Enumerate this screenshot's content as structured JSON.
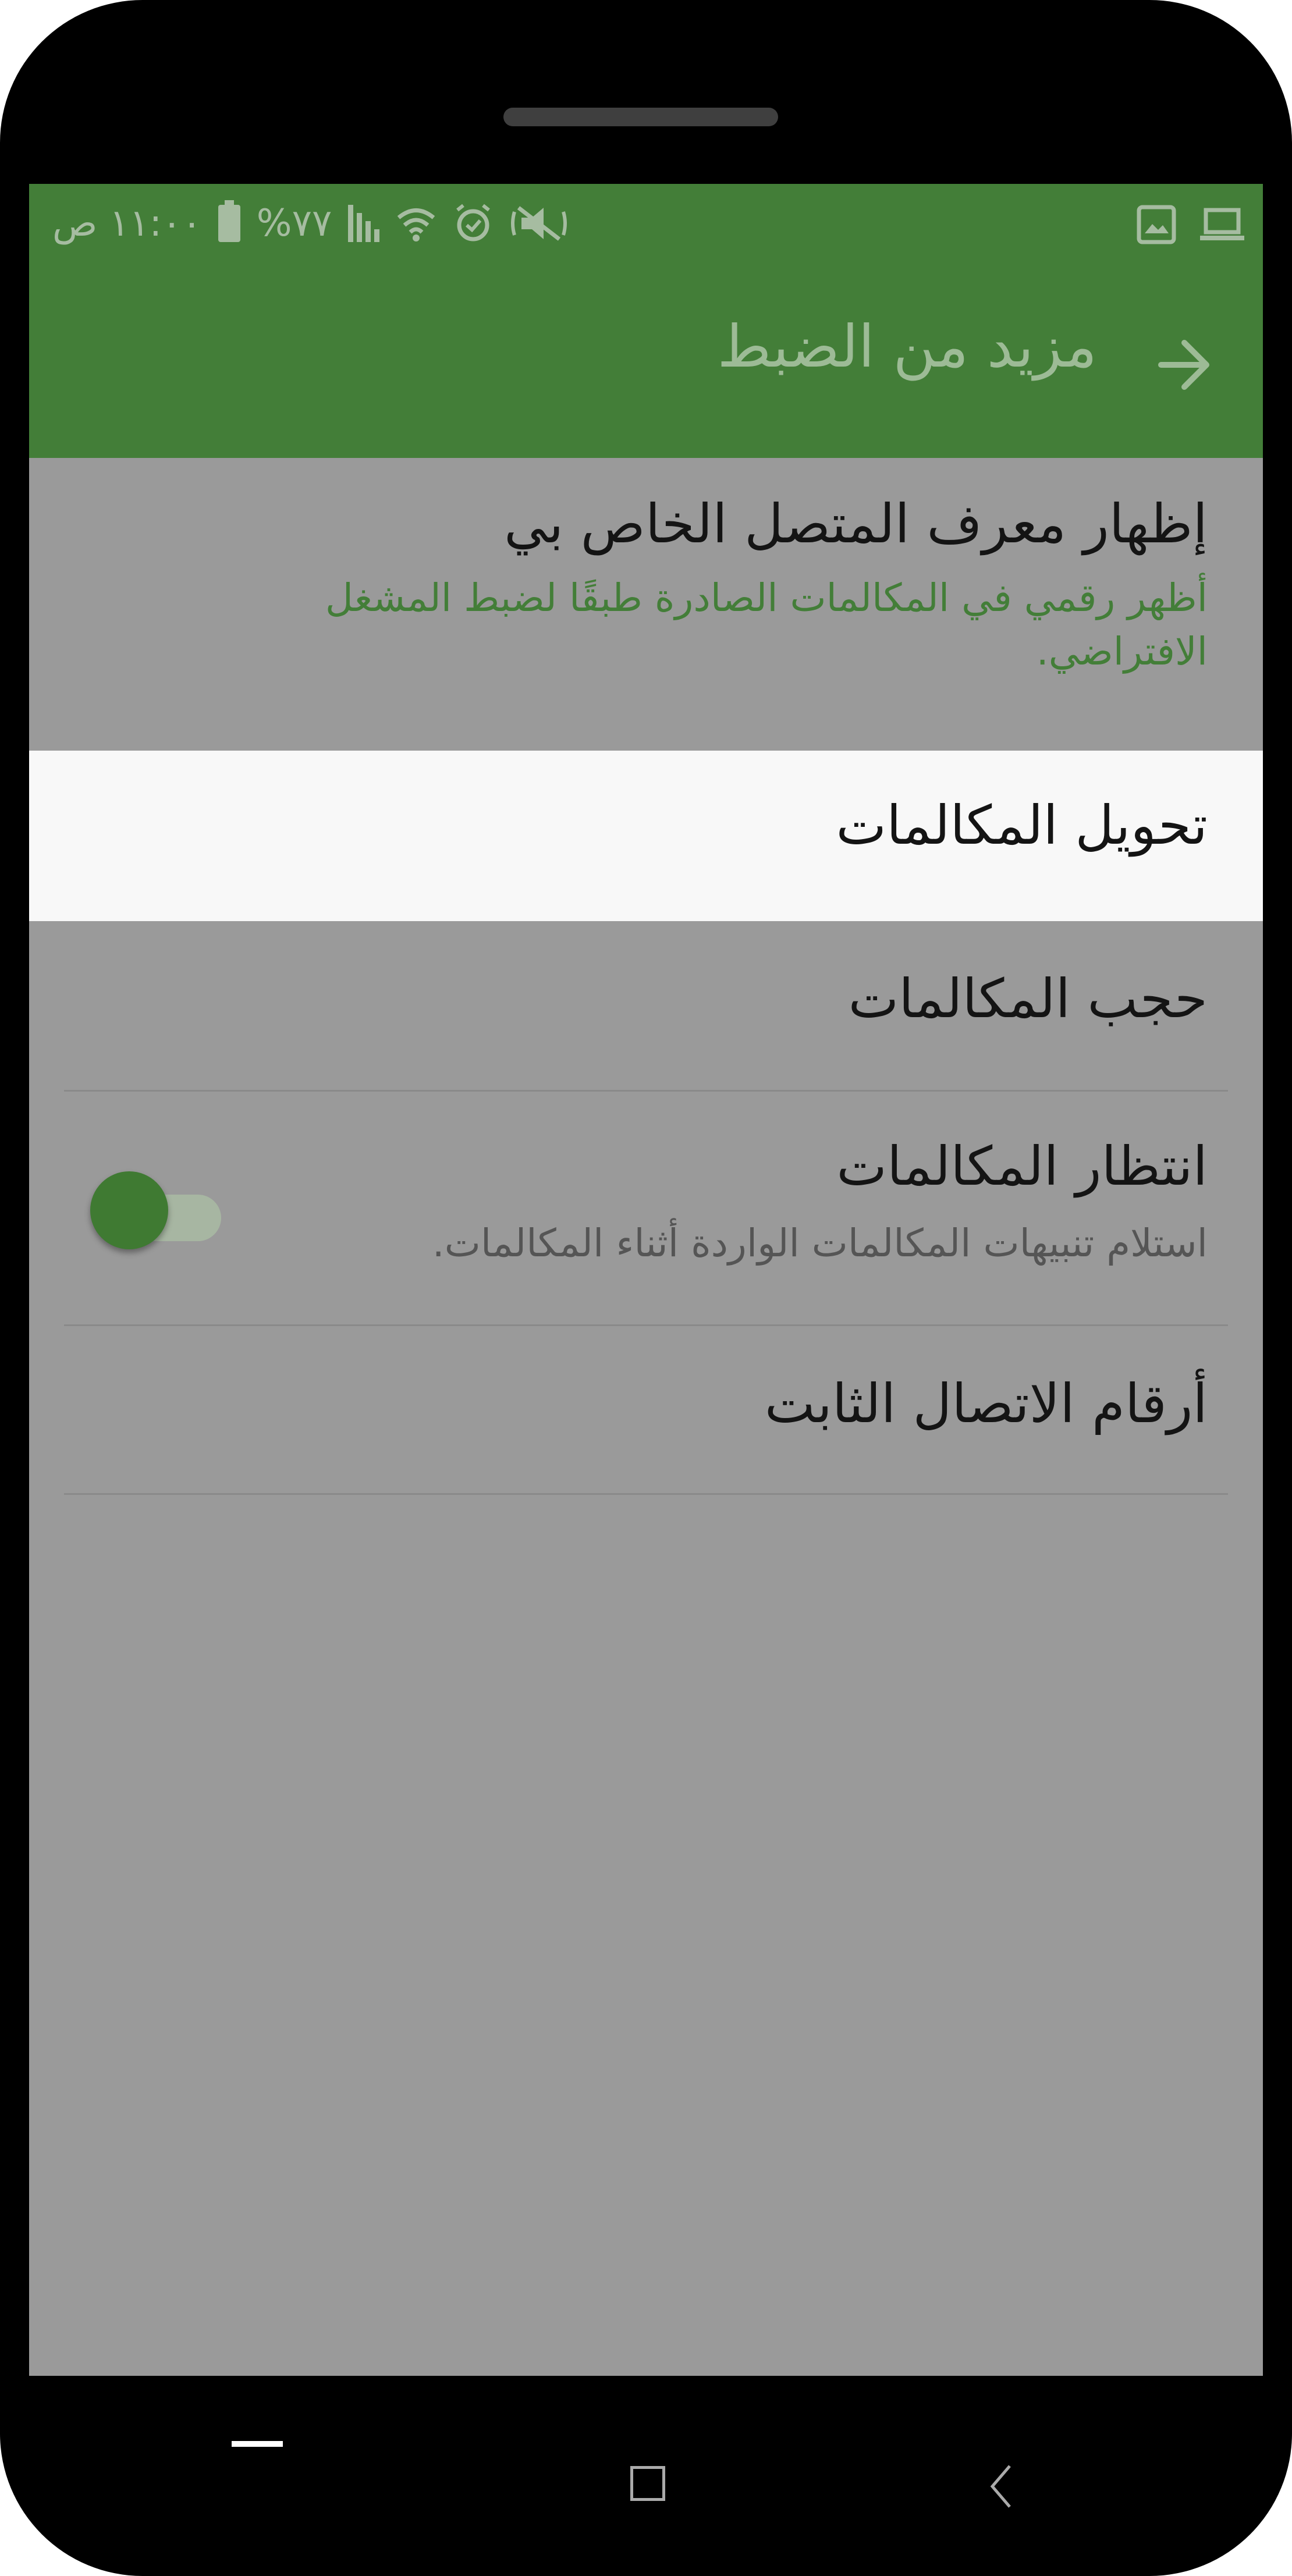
{
  "status_bar": {
    "time": "١١:٠٠ ص",
    "battery": "%٧٧",
    "icons": [
      "battery-icon",
      "signal-icon",
      "wifi-icon",
      "alarm-icon",
      "mute-icon",
      "gallery-icon",
      "laptop-icon"
    ]
  },
  "toolbar": {
    "title": "مزيد من الضبط",
    "back_icon": "arrow-back-icon"
  },
  "settings": {
    "caller_id": {
      "title": "إظهار معرف المتصل الخاص بي",
      "summary": "أظهر رقمي في المكالمات الصادرة طبقًا لضبط المشغل الافتراضي."
    },
    "call_forwarding": {
      "title": "تحويل المكالمات"
    },
    "call_barring": {
      "title": "حجب المكالمات"
    },
    "call_waiting": {
      "title": "انتظار المكالمات",
      "summary": "استلام تنبيهات المكالمات الواردة أثناء المكالمات.",
      "enabled": true
    },
    "fixed_dialing": {
      "title": "أرقام الاتصال الثابت"
    }
  },
  "colors": {
    "accent": "#437e38",
    "dim_overlay": "#9a9a9a",
    "highlight_row": "#f8f8f8"
  },
  "nav_bar": {
    "icons": [
      "recent-apps-icon",
      "home-icon",
      "back-icon"
    ]
  }
}
